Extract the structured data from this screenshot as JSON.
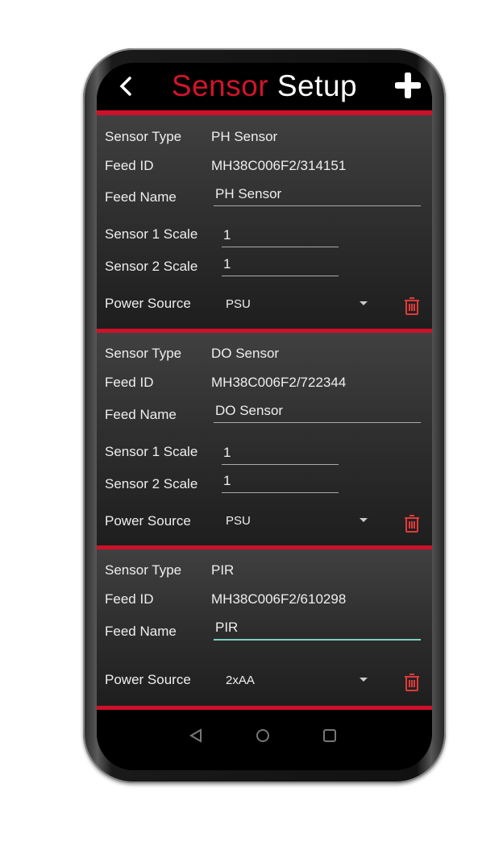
{
  "header": {
    "title_part1": "Sensor",
    "title_part2": "Setup",
    "back_icon": "chevron-left-icon",
    "add_icon": "plus-icon"
  },
  "labels": {
    "sensor_type": "Sensor Type",
    "feed_id": "Feed ID",
    "feed_name": "Feed Name",
    "sensor1_scale": "Sensor 1 Scale",
    "sensor2_scale": "Sensor 2 Scale",
    "power_source": "Power Source"
  },
  "sensors": [
    {
      "type": "PH Sensor",
      "feed_id": "MH38C006F2/314151",
      "feed_name": "PH Sensor",
      "scale1": "1",
      "scale2": "1",
      "power": "PSU"
    },
    {
      "type": "DO Sensor",
      "feed_id": "MH38C006F2/722344",
      "feed_name": "DO Sensor",
      "scale1": "1",
      "scale2": "1",
      "power": "PSU"
    },
    {
      "type": "PIR",
      "feed_id": "MH38C006F2/610298",
      "feed_name": "PIR",
      "power": "2xAA"
    }
  ],
  "colors": {
    "accent": "#d0102a",
    "focus": "#7fcfbf",
    "trash": "#e03a3a"
  },
  "nav": {
    "icons": [
      "back-triangle-icon",
      "home-circle-icon",
      "recents-square-icon"
    ]
  }
}
